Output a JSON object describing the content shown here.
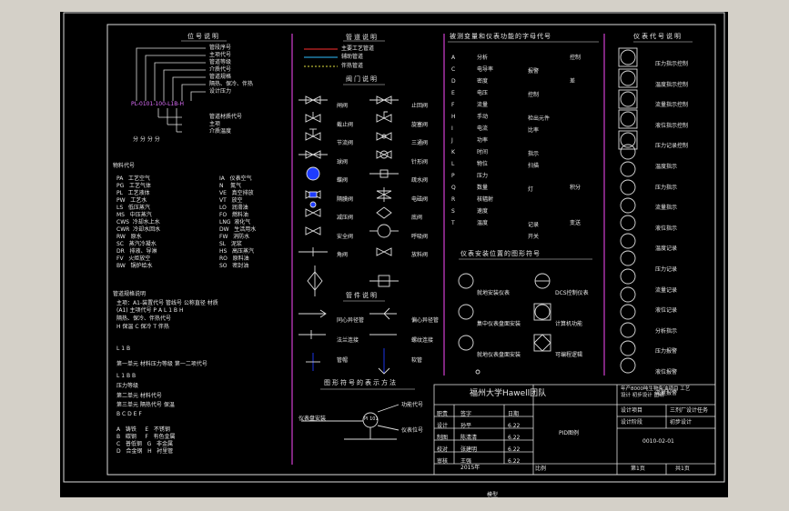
{
  "left": {
    "tag_heading": "位号说明",
    "tag_desc": [
      "管段序号",
      "主项代号",
      "管道等级",
      "介质代号",
      "管道规格",
      "隔热、保冷、伴热",
      "设计压力",
      "管道材质代号",
      "主项",
      "介质温度"
    ],
    "tag_example": "PL-0101-100-L1B-H",
    "units_row": "分   分   分   分",
    "medium_title": "物料代号",
    "medium_col1": "PA   工艺空气\nPG   工艺气体\nPL   工艺液体\nPW   工艺水\nLS   低压蒸汽\nMS   中压蒸汽\nCWS  冷却水上水\nCWR  冷却水回水\nRW   原水\nSC   蒸汽冷凝水\nDR   排液、导淋\nFV   火炬放空\nBW   锅炉给水",
    "medium_col2": "IA   仪表空气\nN    氮气\nVE   真空排放\nVT   放空\nLO   润滑油\nFO   燃料油\nLNG  液化气\nDW   生活用水\nFW   消防水\nSL   泥浆\nHS   高压蒸汽\nRO   原料油\nSO   密封油",
    "spec_title": "管道规格说明",
    "spec_lines": [
      "主项：A1-装置代号 管线号 公称直径 材质",
      "    (A1) 主项代号 P A L 1 B H",
      "隔热、保冷、伴热代号",
      "    H 保温  C 保冷  T 伴热"
    ],
    "grade_rows": [
      "L   1   B",
      "第一单元   材料压力等级  第一二项代号",
      "L   1   B   B",
      "压力等级",
      "第二单元   材料代号",
      "第三单元   隔热代号   保温",
      "B   C   D   E   F"
    ],
    "grade_legend": "A   铸铁     E   不锈钢\nB   碳钢     F   有色金属\nC   普低钢   G   非金属\nD   合金钢   H   衬里管"
  },
  "pipes": {
    "heading": "管道说明",
    "items": [
      "主要工艺管道",
      "辅助管道",
      "伴热管道"
    ]
  },
  "valves": {
    "heading": "阀门说明",
    "left": "闸阀\n截止阀\n节流阀\n球阀\n蝶阀\n隔膜阀\n减压阀\n安全阀\n角阀",
    "right": "止回阀\n旋塞阀\n三通阀\n针形阀\n疏水阀\n电磁阀\n底阀\n呼吸阀\n放料阀"
  },
  "fittings": {
    "heading": "管件说明",
    "left": "同心异径管\n法兰连接\n管帽",
    "right": "偏心异径管\n螺纹连接\n软管"
  },
  "notation": {
    "heading": "图形符号的表示方法",
    "left": "仪表盘安装",
    "circle": "PI 101",
    "top": "功能代号",
    "bottom": "仪表位号"
  },
  "functions": {
    "heading": "被测变量和仪表功能的字母代号",
    "col_a": "A\nC\nD\nE\nF\nH\nI\nJ\nK\nL\nP\nQ\nR\nS\nT",
    "col_b": "分析\n电导率\n密度\n电压\n流量\n手动\n电流\n功率\n时间\n物位\n压力\n数量\n核辐射\n速度\n温度",
    "col_c": "报警\n\n控制\n\n检出元件\n比率\n\n指示\n扫描\n\n灯\n\n\n记录\n开关",
    "col_d": "控制\n\n差\n\n\n\n\n\n\n\n\n积分\n\n\n变送"
  },
  "display": {
    "heading": "仪表安装位置的图形符号",
    "left": "就地安装仪表\n集中仪表盘面安装\n就地仪表盘面安装",
    "right": "DCS控制仪表\n计算机功能\n可编程逻辑"
  },
  "instruments": {
    "heading": "仪表代号说明",
    "names": "压力指示控制\n温度指示控制\n流量指示控制\n液位指示控制\n压力记录控制\n温度指示\n压力指示\n流量指示\n液位指示\n温度记录\n压力记录\n流量记录\n液位记录\n分析指示\n压力报警\n液位报警\n流量报警"
  },
  "title_block": {
    "team": "福州大学Hawell团队",
    "project_note": "年产8000吨生物柴油项目 工艺\n设计 初步设计 图纸",
    "design_project": "设计项目",
    "design_project_value": "三剂厂设计任务",
    "design_stage": "设计阶段",
    "design_stage_value": "初步设计",
    "drawing_no": "0010-02-01",
    "drawing_title": "PID图例",
    "roles": "职责\n设计\n制图\n校对\n审核",
    "names": "签字\n孙平\n陈清清\n张建明\n王强",
    "dates": "日期\n6.22\n6.22\n6.22\n6.22",
    "year": "2015年",
    "scale": "比例",
    "sheet": "第1页",
    "total": "共1页"
  },
  "footer": {
    "model_label": "模型"
  },
  "colors": {
    "sheet_background": "#000000",
    "divider": "#d040d0",
    "main_pipe": "#ff3030",
    "aux_pipe": "#30c0ff",
    "heat_pipe": "#e0e040",
    "symbol_fill": "#1e3cff"
  }
}
